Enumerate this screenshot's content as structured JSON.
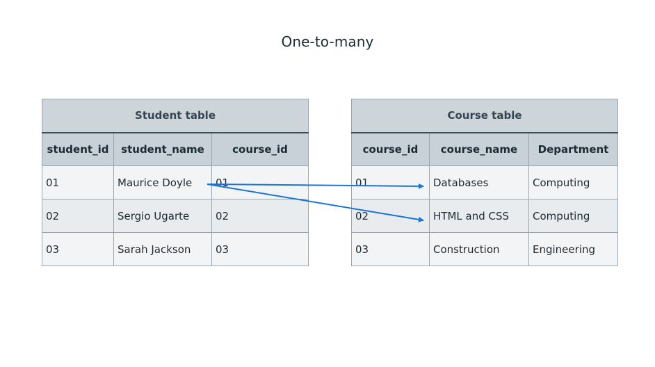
{
  "title": "One-to-many",
  "student_table": {
    "caption": "Student table",
    "columns": [
      "student_id",
      "student_name",
      "course_id"
    ],
    "rows": [
      [
        "01",
        "Maurice Doyle",
        "01"
      ],
      [
        "02",
        "Sergio Ugarte",
        "02"
      ],
      [
        "03",
        "Sarah Jackson",
        "03"
      ]
    ]
  },
  "course_table": {
    "caption": "Course table",
    "columns": [
      "course_id",
      "course_name",
      "Department"
    ],
    "rows": [
      [
        "01",
        "Databases",
        "Computing"
      ],
      [
        "02",
        "HTML and CSS",
        "Computing"
      ],
      [
        "03",
        "Construction",
        "Engineering"
      ]
    ]
  },
  "connector_color": "#1a73d6"
}
